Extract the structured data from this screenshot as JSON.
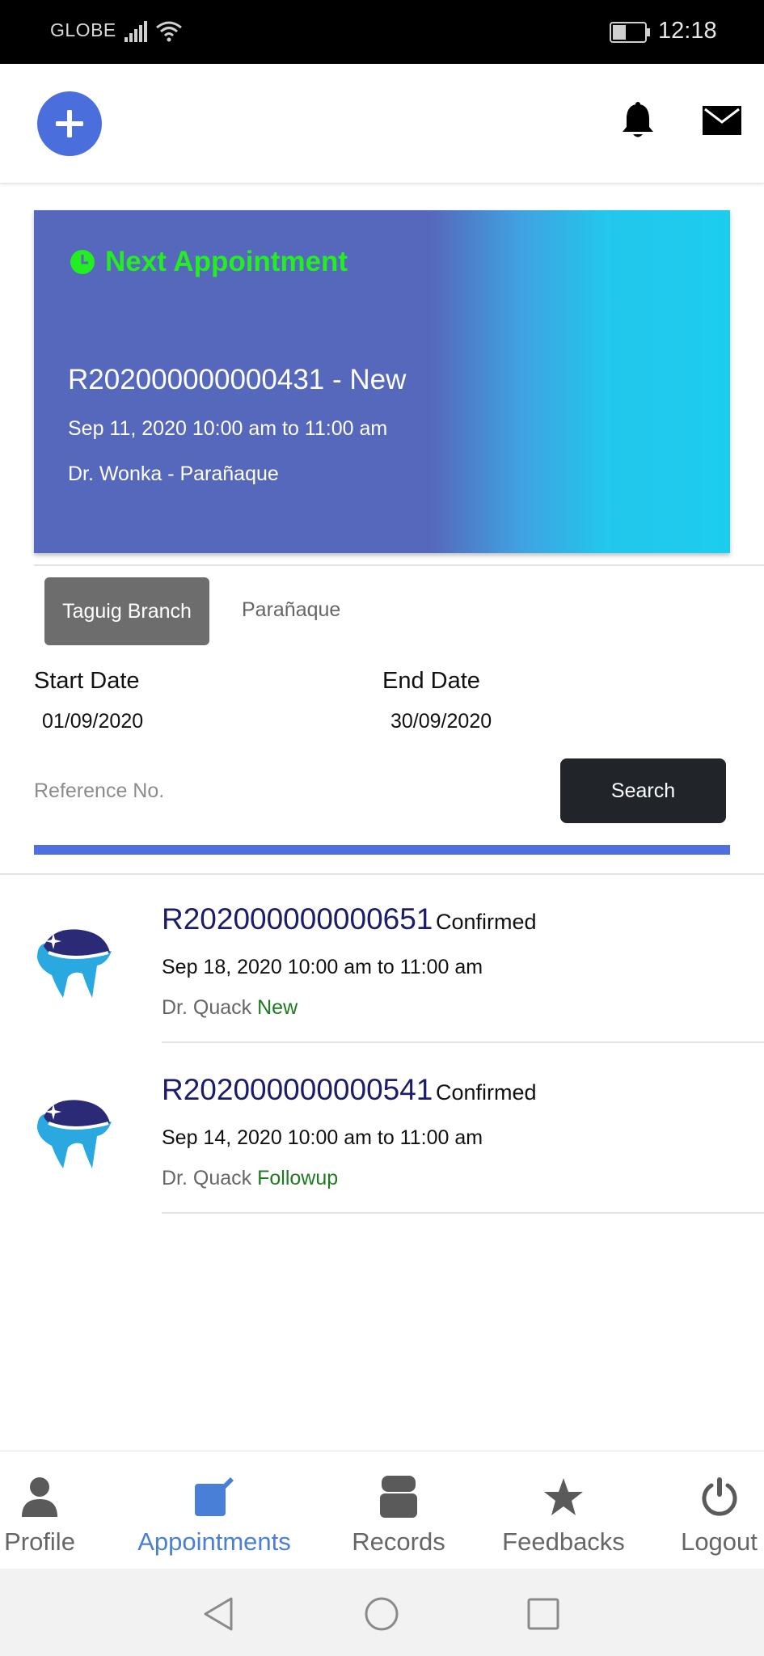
{
  "status_bar": {
    "carrier": "GLOBE",
    "time": "12:18"
  },
  "header": {
    "add_icon": "plus-icon",
    "notifications_icon": "bell-icon",
    "messages_icon": "mail-icon"
  },
  "next_appointment": {
    "heading": "Next Appointment",
    "reference": "R202000000000431 - New",
    "schedule": "Sep 11, 2020 10:00 am to 11:00 am",
    "doctor_branch": "Dr. Wonka - Parañaque",
    "colors": {
      "heading": "#22ee22",
      "card_start": "#5668bb",
      "card_end": "#1ccdee"
    }
  },
  "branches": {
    "active": "Taguig Branch",
    "other": "Parañaque"
  },
  "filters": {
    "start_label": "Start Date",
    "start_value": "01/09/2020",
    "end_label": "End Date",
    "end_value": "30/09/2020",
    "reference_placeholder": "Reference No.",
    "search_label": "Search"
  },
  "appointments": [
    {
      "reference": "R202000000000651",
      "status": "Confirmed",
      "schedule": "Sep 18, 2020 10:00 am to 11:00 am",
      "doctor": "Dr. Quack",
      "type": "New"
    },
    {
      "reference": "R202000000000541",
      "status": "Confirmed",
      "schedule": "Sep 14, 2020 10:00 am to 11:00 am",
      "doctor": "Dr. Quack",
      "type": "Followup"
    }
  ],
  "bottom_nav": {
    "items": [
      {
        "label": "Profile",
        "icon": "person-icon"
      },
      {
        "label": "Appointments",
        "icon": "edit-calendar-icon",
        "active": true
      },
      {
        "label": "Records",
        "icon": "folder-icon"
      },
      {
        "label": "Feedbacks",
        "icon": "star-icon"
      },
      {
        "label": "Logout",
        "icon": "power-icon"
      }
    ],
    "active_color": "#4a7fd8"
  }
}
